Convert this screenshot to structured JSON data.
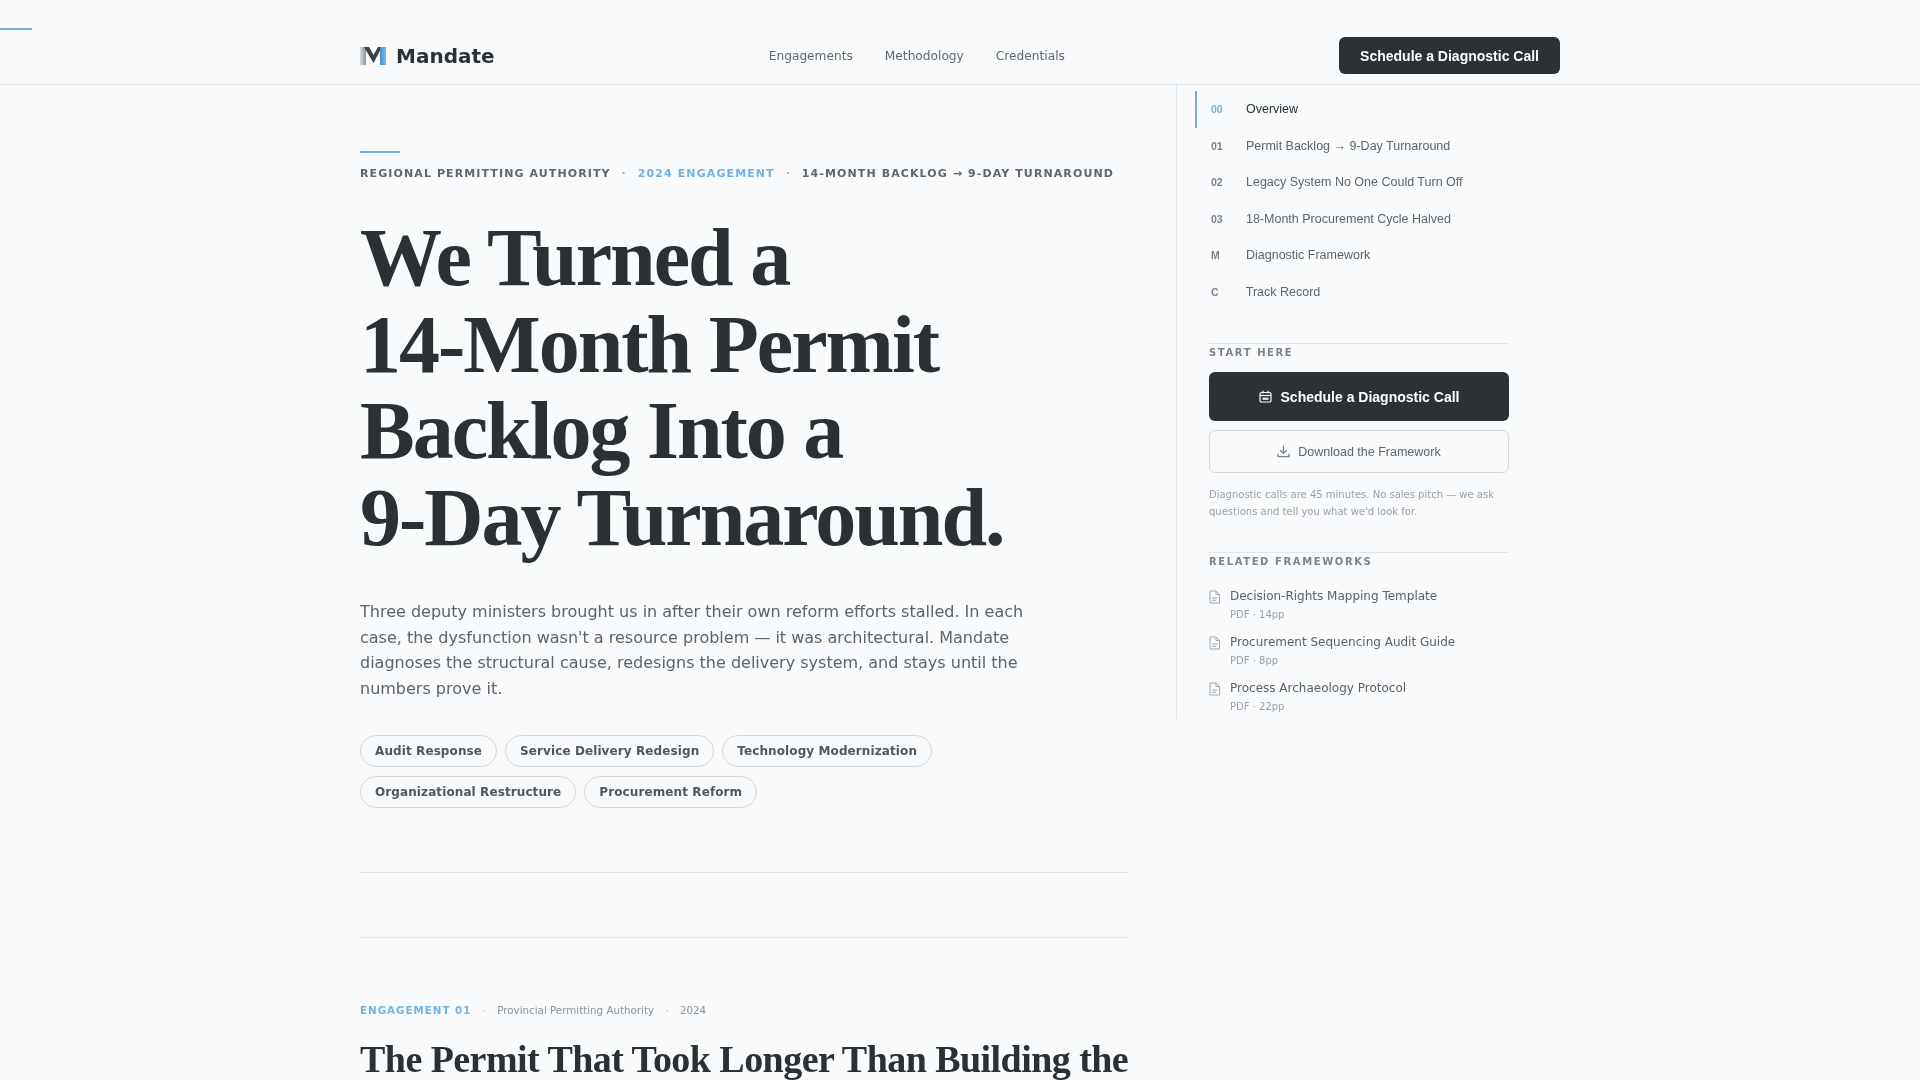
{
  "header": {
    "logo": "Mandate",
    "nav": [
      "Engagements",
      "Methodology",
      "Credentials"
    ],
    "cta": "Schedule a Diagnostic Call"
  },
  "hero": {
    "eyebrow": [
      {
        "text": "REGIONAL PERMITTING AUTHORITY",
        "kind": "label"
      },
      {
        "text": "·",
        "kind": "separator"
      },
      {
        "text": "2024 ENGAGEMENT",
        "kind": "accent"
      },
      {
        "text": "·",
        "kind": "separator"
      },
      {
        "text": "14-MONTH BACKLOG → 9-DAY TURNAROUND",
        "kind": "label"
      }
    ],
    "headline": "We Turned a 14-Month Permit Backlog Into a 9-Day Turnaround.",
    "intro": "Three deputy ministers brought us in after their own reform efforts stalled. In each case, the dysfunction wasn't a resource problem — it was architectural. Mandate diagnoses the structural cause, redesigns the delivery system, and stays until the numbers prove it.",
    "tags": [
      "Audit Response",
      "Service Delivery Redesign",
      "Technology Modernization",
      "Organizational Restructure",
      "Procurement Reform"
    ]
  },
  "engagement": {
    "meta": [
      {
        "text": "ENGAGEMENT 01",
        "kind": "accent"
      },
      {
        "text": "·",
        "kind": "separator"
      },
      {
        "text": "Provincial Permitting Authority",
        "kind": "label"
      },
      {
        "text": "·",
        "kind": "separator"
      },
      {
        "text": "2024",
        "kind": "label"
      }
    ],
    "title": "The Permit That Took Longer Than Building the"
  },
  "sidebar": {
    "toc": [
      {
        "number": "00",
        "label": "Overview",
        "selected": true
      },
      {
        "number": "01",
        "label": "Permit Backlog → 9-Day Turnaround",
        "selected": false
      },
      {
        "number": "02",
        "label": "Legacy System No One Could Turn Off",
        "selected": false
      },
      {
        "number": "03",
        "label": "18-Month Procurement Cycle Halved",
        "selected": false
      },
      {
        "number": "M",
        "label": "Diagnostic Framework",
        "selected": false
      },
      {
        "number": "C",
        "label": "Track Record",
        "selected": false
      }
    ],
    "start_here": {
      "heading": "START HERE",
      "primary_button": "Schedule a Diagnostic Call",
      "secondary_button": "Download the Framework",
      "note": "Diagnostic calls are 45 minutes. No sales pitch — we ask questions and tell you what we'd look for."
    },
    "related": {
      "heading": "RELATED FRAMEWORKS",
      "items": [
        {
          "title": "Decision-Rights Mapping Template",
          "meta": "PDF · 14pp"
        },
        {
          "title": "Procurement Sequencing Audit Guide",
          "meta": "PDF · 8pp"
        },
        {
          "title": "Process Archaeology Protocol",
          "meta": "PDF · 22pp"
        }
      ]
    }
  }
}
